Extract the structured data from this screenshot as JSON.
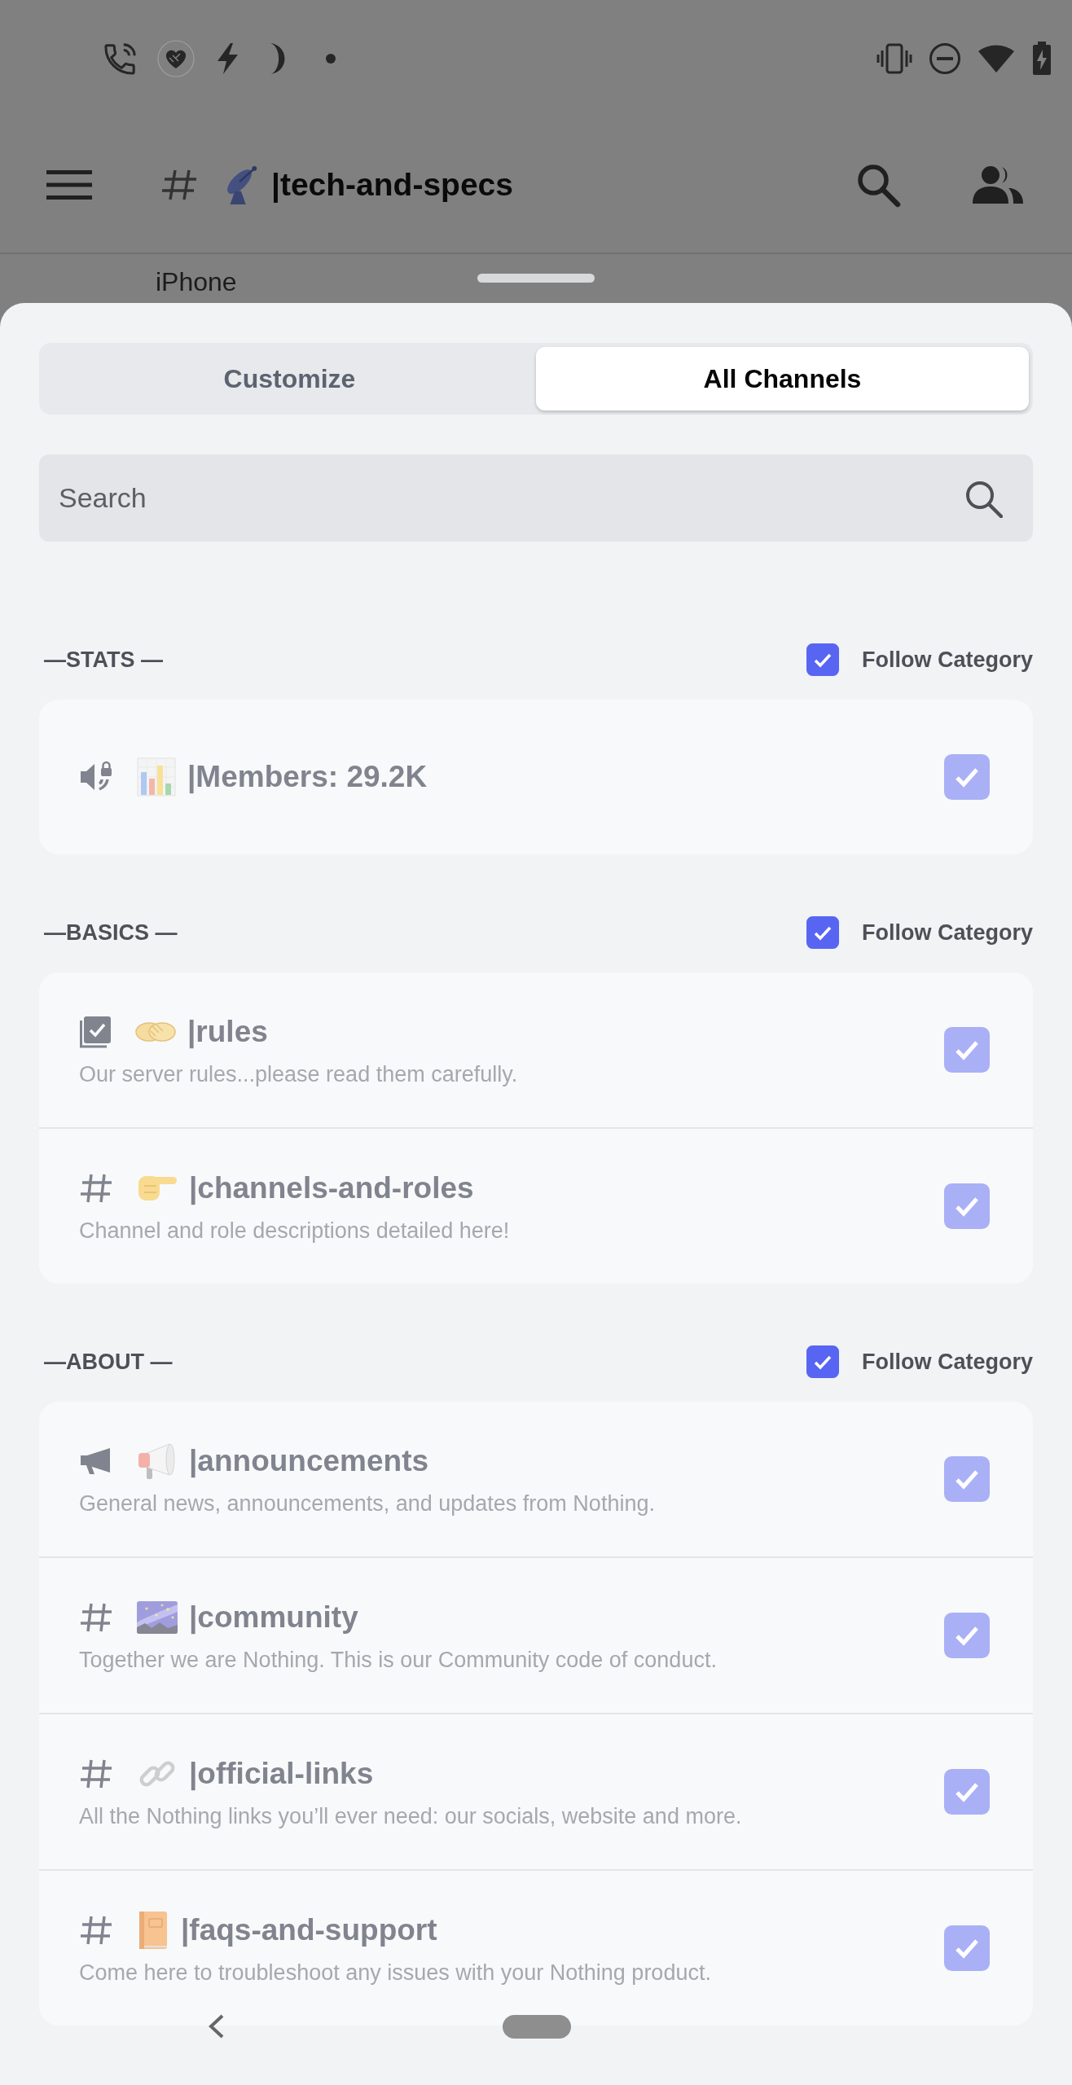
{
  "channel_header": {
    "title": "|tech-and-specs"
  },
  "background_message": {
    "text": "iPhone"
  },
  "sheet": {
    "tabs": [
      {
        "label": "Customize",
        "selected": false
      },
      {
        "label": "All Channels",
        "selected": true
      }
    ],
    "search": {
      "placeholder": "Search"
    },
    "categories": [
      {
        "name": "—STATS —",
        "follow_label": "Follow Category",
        "checked": true,
        "channels": [
          {
            "kind": "voice_locked",
            "name": "|Members: 29.2K",
            "checked": true,
            "disabled": true
          }
        ]
      },
      {
        "name": "—BASICS —",
        "follow_label": "Follow Category",
        "checked": true,
        "channels": [
          {
            "kind": "rules",
            "name": "|rules",
            "description": "Our server rules...please read them carefully.",
            "checked": true,
            "disabled": true
          },
          {
            "kind": "text",
            "name": "|channels-and-roles",
            "description": "Channel and role descriptions detailed here!",
            "checked": true,
            "disabled": true
          }
        ]
      },
      {
        "name": "—ABOUT —",
        "follow_label": "Follow Category",
        "checked": true,
        "channels": [
          {
            "kind": "announcement",
            "name": "|announcements",
            "description": "General news, announcements, and updates from Nothing.",
            "checked": true,
            "disabled": true
          },
          {
            "kind": "text",
            "name": "|community",
            "description": "Together we are Nothing. This is our Community code of conduct.",
            "checked": true,
            "disabled": true
          },
          {
            "kind": "text",
            "name": "|official-links",
            "description": "All the Nothing links you’ll ever need: our socials, website and more.",
            "checked": true,
            "disabled": true
          },
          {
            "kind": "text",
            "name": "|faqs-and-support",
            "description": "Come here to troubleshoot any issues with your Nothing product.",
            "checked": true,
            "disabled": true
          }
        ]
      }
    ]
  }
}
